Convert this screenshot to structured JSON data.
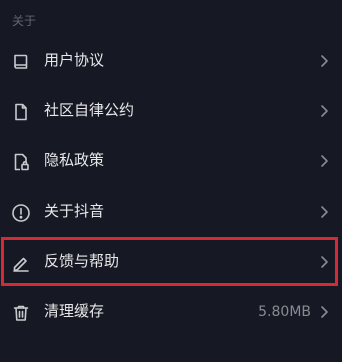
{
  "section": {
    "title": "关于"
  },
  "items": [
    {
      "label": "用户协议",
      "icon": "book-icon",
      "value": ""
    },
    {
      "label": "社区自律公约",
      "icon": "document-icon",
      "value": ""
    },
    {
      "label": "隐私政策",
      "icon": "privacy-lock-document-icon",
      "value": ""
    },
    {
      "label": "关于抖音",
      "icon": "exclamation-circle-icon",
      "value": ""
    },
    {
      "label": "反馈与帮助",
      "icon": "pencil-icon",
      "value": ""
    },
    {
      "label": "清理缓存",
      "icon": "trash-icon",
      "value": "5.80MB"
    }
  ],
  "colors": {
    "background": "#161823",
    "text": "#e8e8ea",
    "muted": "#64656c",
    "icon": "#c9cacd",
    "highlight": "#d42a35"
  }
}
